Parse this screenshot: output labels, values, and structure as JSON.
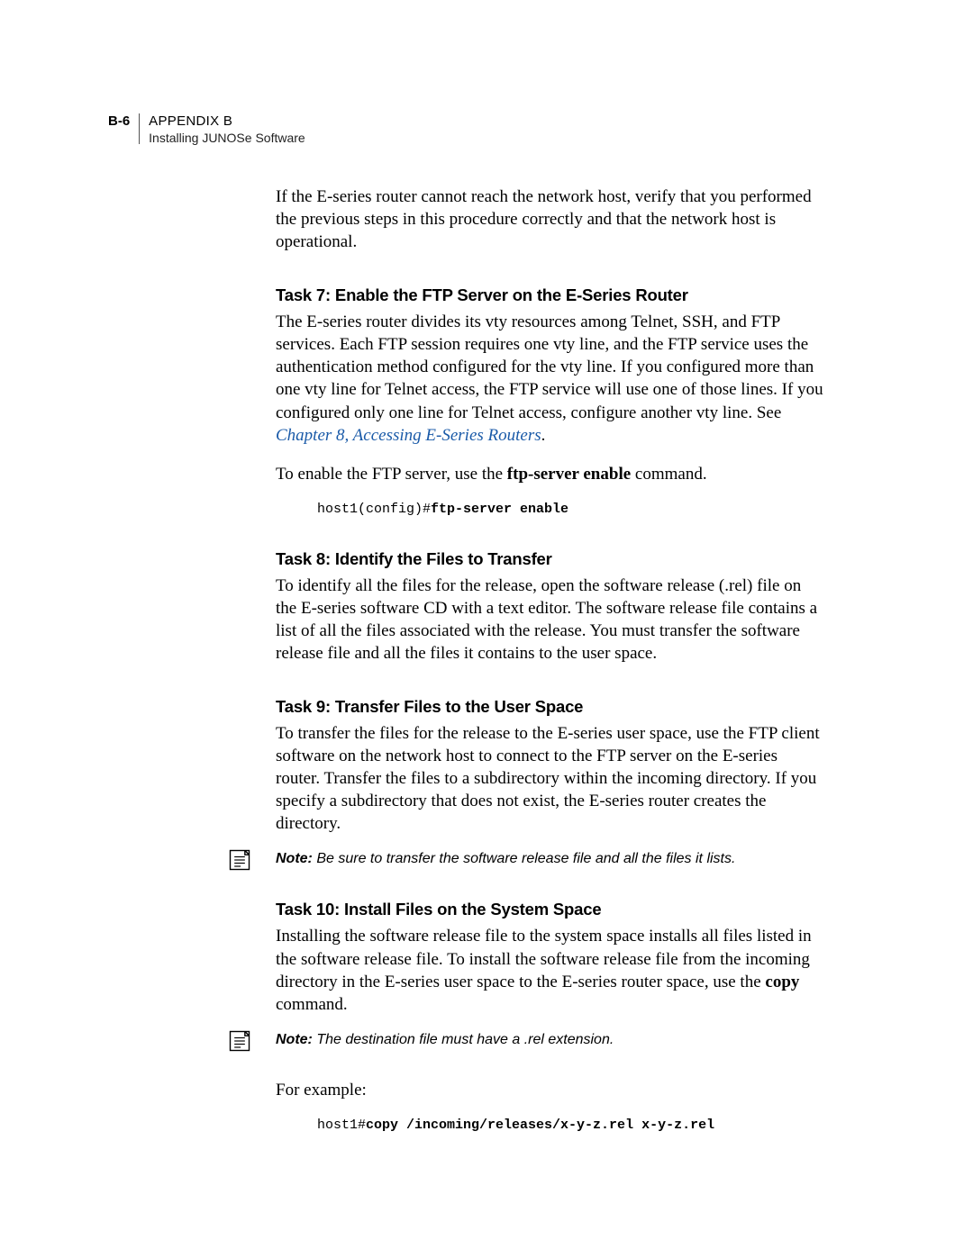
{
  "header": {
    "pagenum": "B-6",
    "appendix": "APPENDIX B",
    "subtitle": "Installing JUNOSe Software"
  },
  "intro": {
    "para": "If the E-series router cannot reach the network host, verify that you performed the previous steps in this procedure correctly and that the network host is operational."
  },
  "task7": {
    "heading": "Task 7: Enable the FTP Server on the E-Series Router",
    "para1a": "The E-series router divides its vty resources among Telnet, SSH, and FTP services. Each FTP session requires one vty line, and the FTP service uses the authentication method configured for the vty line. If you configured more than one vty line for Telnet access, the FTP service will use one of those lines. If you configured only one line for Telnet access, configure another vty line. See ",
    "link": "Chapter 8, Accessing E-Series Routers",
    "para1b": ".",
    "para2a": "To enable the FTP server, use the ",
    "para2bold": "ftp-server enable",
    "para2b": " command.",
    "code_prefix": "host1(config)#",
    "code_cmd": "ftp-server enable"
  },
  "task8": {
    "heading": "Task 8: Identify the Files to Transfer",
    "para": "To identify all the files for the release, open the software release (.rel) file on the E-series software CD with a text editor. The software release file contains a list of all the files associated with the release. You must transfer the software release file and all the files it contains to the user space."
  },
  "task9": {
    "heading": "Task 9: Transfer Files to the User Space",
    "para": "To transfer the files for the release to the E-series user space, use the FTP client software on the network host to connect to the FTP server on the E-series router. Transfer the files to a subdirectory within the incoming directory. If you specify a subdirectory that does not exist, the E-series router creates the directory.",
    "note_label": "Note:",
    "note_text": " Be sure to transfer the software release file and all the files it lists."
  },
  "task10": {
    "heading": "Task 10: Install Files on the System Space",
    "para1a": "Installing the software release file to the system space installs all files listed in the software release file. To install the software release file from the incoming directory in the E-series user space to the E-series router space, use the ",
    "para1bold": "copy",
    "para1b": " command.",
    "note_label": "Note:",
    "note_text": " The destination file must have a .rel extension.",
    "para2": "For example:",
    "code_prefix": "host1#",
    "code_cmd": "copy /incoming/releases/x-y-z.rel x-y-z.rel"
  }
}
